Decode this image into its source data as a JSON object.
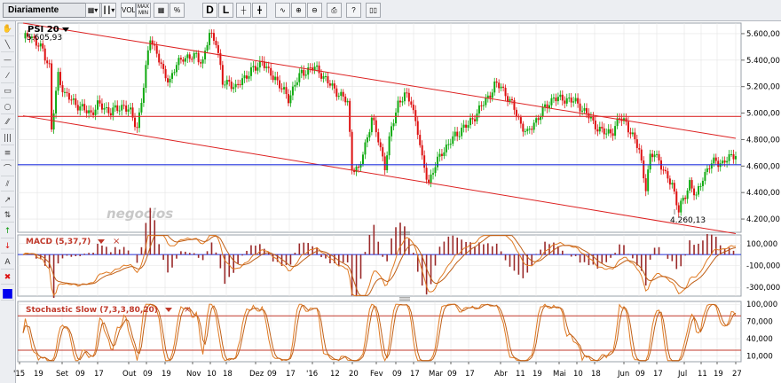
{
  "toolbar": {
    "timeframe": "Diariamente",
    "buttons": [
      {
        "name": "bar-type-button",
        "label": "▦▾"
      },
      {
        "name": "candle-type-button",
        "label": "┃┃▾"
      },
      {
        "name": "vol-button",
        "label": "VOL"
      },
      {
        "name": "maxmin-button",
        "label": "MAX MIN"
      },
      {
        "name": "grid-button",
        "label": "▦"
      },
      {
        "name": "percent-button",
        "label": "%"
      },
      {
        "name": "draw-d-button",
        "label": "D"
      },
      {
        "name": "draw-l-button",
        "label": "L"
      },
      {
        "name": "crosshair-button",
        "label": "┼"
      },
      {
        "name": "crosshair2-button",
        "label": "╋"
      },
      {
        "name": "compare-button",
        "label": "∿"
      },
      {
        "name": "zoom-in-button",
        "label": "⊕"
      },
      {
        "name": "zoom-out-button",
        "label": "⊖"
      },
      {
        "name": "print-button",
        "label": "⎙"
      },
      {
        "name": "help-button",
        "label": "?"
      },
      {
        "name": "book-button",
        "label": "▯▯"
      }
    ]
  },
  "sidebar": {
    "tools": [
      "✋",
      "╲",
      "—",
      "⁄",
      "▭",
      "○",
      "⁄⁄",
      "|||",
      "≡",
      "⌒",
      "⫽",
      "↗",
      "⇅",
      "↑",
      "↓",
      "A",
      "✖",
      "■"
    ],
    "colors": {
      "up": "#119911",
      "down": "#dd1111",
      "blue": "#0000ee"
    }
  },
  "main": {
    "symbol": "PSI 20",
    "last_value": "5.605,93",
    "low_label": "4.260,13",
    "watermark": "negocios",
    "price_axis": [
      "5.600,00",
      "5.400,00",
      "5.200,00",
      "5.000,00",
      "4.800,00",
      "4.600,00",
      "4.400,00",
      "4.200,00"
    ]
  },
  "macd": {
    "title": "MACD (5,37,7)",
    "axis": [
      "100,000",
      "-100,000",
      "-300,000"
    ]
  },
  "stochastic": {
    "title": "Stochastic Slow (7,3,3,80,20)",
    "axis": [
      "100,000",
      "70,000",
      "40,000",
      "10,000"
    ]
  },
  "x_axis": [
    "'15",
    "19",
    "Set",
    "09",
    "17",
    "Out",
    "09",
    "19",
    "Nov",
    "10",
    "18",
    "Dez",
    "09",
    "17",
    "'16",
    "12",
    "20",
    "Fev",
    "09",
    "17",
    "Mar",
    "09",
    "17",
    "Abr",
    "11",
    "19",
    "Mai",
    "10",
    "18",
    "Jun",
    "09",
    "17",
    "Jul",
    "11",
    "19",
    "27"
  ],
  "colors": {
    "up": "#11aa11",
    "down": "#dd1111",
    "channel": "#dd2222",
    "hline_red": "#dd3333",
    "hline_blue": "#2233dd",
    "hist": "#9a2a2a",
    "osc": "#e07a22",
    "grid": "#e4e4e4"
  },
  "chart_data": {
    "type": "candlestick",
    "symbol": "PSI 20",
    "ylim": [
      4100,
      5680
    ],
    "points": [
      [
        0,
        5550
      ],
      [
        3,
        5605
      ],
      [
        6,
        5520
      ],
      [
        9,
        5480
      ],
      [
        12,
        5350
      ],
      [
        13,
        4870
      ],
      [
        16,
        5290
      ],
      [
        19,
        5140
      ],
      [
        22,
        5100
      ],
      [
        25,
        5060
      ],
      [
        28,
        5020
      ],
      [
        31,
        5000
      ],
      [
        34,
        5060
      ],
      [
        37,
        5040
      ],
      [
        40,
        5010
      ],
      [
        43,
        5030
      ],
      [
        46,
        5060
      ],
      [
        49,
        5000
      ],
      [
        52,
        4890
      ],
      [
        55,
        5200
      ],
      [
        58,
        5580
      ],
      [
        61,
        5450
      ],
      [
        64,
        5300
      ],
      [
        67,
        5250
      ],
      [
        70,
        5360
      ],
      [
        73,
        5430
      ],
      [
        76,
        5410
      ],
      [
        79,
        5440
      ],
      [
        82,
        5380
      ],
      [
        85,
        5600
      ],
      [
        88,
        5550
      ],
      [
        91,
        5220
      ],
      [
        94,
        5240
      ],
      [
        97,
        5180
      ],
      [
        100,
        5260
      ],
      [
        103,
        5300
      ],
      [
        106,
        5340
      ],
      [
        109,
        5400
      ],
      [
        112,
        5300
      ],
      [
        115,
        5270
      ],
      [
        118,
        5180
      ],
      [
        121,
        5110
      ],
      [
        124,
        5220
      ],
      [
        127,
        5300
      ],
      [
        130,
        5330
      ],
      [
        133,
        5340
      ],
      [
        136,
        5300
      ],
      [
        139,
        5230
      ],
      [
        142,
        5180
      ],
      [
        145,
        5130
      ],
      [
        148,
        5080
      ],
      [
        150,
        4600
      ],
      [
        153,
        4560
      ],
      [
        156,
        4760
      ],
      [
        159,
        4960
      ],
      [
        162,
        4800
      ],
      [
        165,
        4600
      ],
      [
        168,
        4880
      ],
      [
        171,
        5080
      ],
      [
        174,
        5130
      ],
      [
        177,
        5090
      ],
      [
        180,
        4860
      ],
      [
        182,
        4640
      ],
      [
        185,
        4480
      ],
      [
        188,
        4600
      ],
      [
        191,
        4710
      ],
      [
        194,
        4760
      ],
      [
        197,
        4830
      ],
      [
        200,
        4880
      ],
      [
        203,
        4910
      ],
      [
        206,
        4980
      ],
      [
        209,
        5050
      ],
      [
        212,
        5120
      ],
      [
        215,
        5210
      ],
      [
        218,
        5200
      ],
      [
        221,
        5120
      ],
      [
        224,
        5030
      ],
      [
        227,
        4920
      ],
      [
        230,
        4840
      ],
      [
        233,
        4930
      ],
      [
        236,
        4990
      ],
      [
        239,
        5060
      ],
      [
        242,
        5120
      ],
      [
        245,
        5100
      ],
      [
        248,
        5110
      ],
      [
        251,
        5090
      ],
      [
        254,
        5050
      ],
      [
        257,
        5000
      ],
      [
        260,
        4920
      ],
      [
        263,
        4880
      ],
      [
        266,
        4840
      ],
      [
        269,
        4870
      ],
      [
        272,
        4960
      ],
      [
        275,
        4930
      ],
      [
        278,
        4820
      ],
      [
        281,
        4720
      ],
      [
        284,
        4440
      ],
      [
        286,
        4660
      ],
      [
        288,
        4700
      ],
      [
        290,
        4650
      ],
      [
        293,
        4520
      ],
      [
        296,
        4470
      ],
      [
        299,
        4260
      ],
      [
        302,
        4380
      ],
      [
        304,
        4480
      ],
      [
        307,
        4360
      ],
      [
        310,
        4520
      ],
      [
        313,
        4600
      ],
      [
        316,
        4640
      ],
      [
        319,
        4620
      ],
      [
        322,
        4660
      ],
      [
        325,
        4700
      ]
    ],
    "n_days": 325,
    "last": 5605.93,
    "low": 4260.13,
    "channel_upper": [
      [
        0,
        5680
      ],
      [
        325,
        4810
      ]
    ],
    "channel_lower": [
      [
        0,
        4980
      ],
      [
        325,
        4090
      ]
    ],
    "hline_red": 4975,
    "hline_blue": 4610,
    "macd_ylim": [
      -380,
      180
    ],
    "stoch_ylim": [
      0,
      105
    ],
    "stoch_levels": [
      80,
      20
    ]
  }
}
